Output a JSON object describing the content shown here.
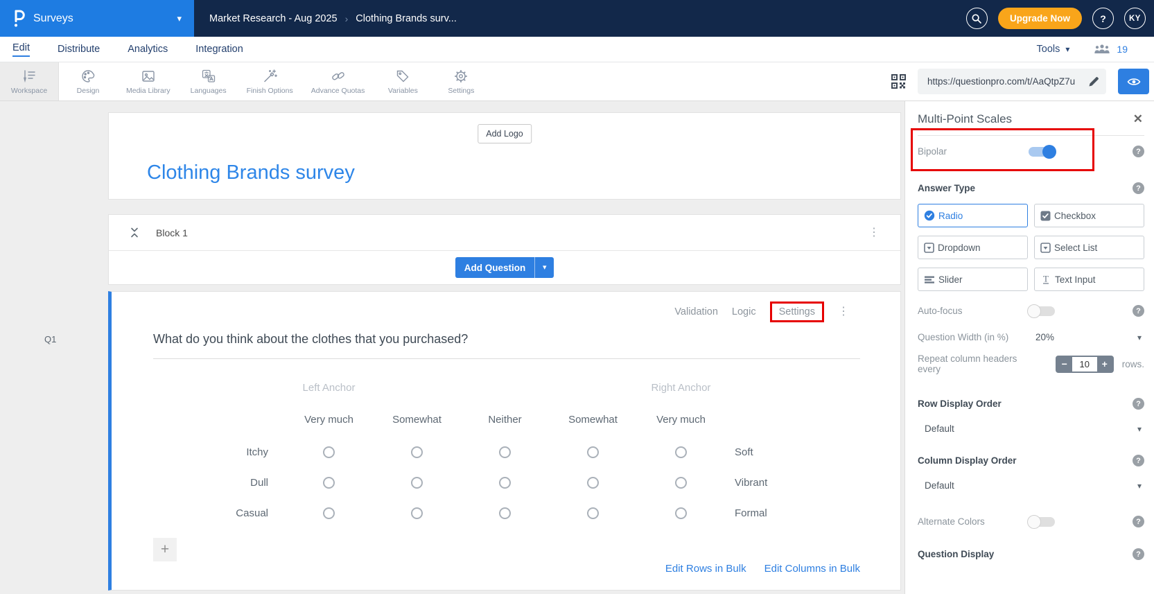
{
  "icons": {
    "help": "?",
    "kebab": "⋮",
    "close": "✕",
    "caret_down": "▾",
    "plus": "+",
    "minus": "−"
  },
  "colors": {
    "navy": "#12284a",
    "brand_blue": "#1e7ce2",
    "accent_blue": "#2e7fe1",
    "title_blue": "#2e86e8",
    "orange": "#f9a51a",
    "highlight_red": "#e60000"
  },
  "topbar": {
    "product": "Surveys",
    "breadcrumb": [
      "Market Research - Aug 2025",
      "Clothing Brands surv..."
    ],
    "breadcrumb_separator": "›",
    "upgrade_label": "Upgrade Now",
    "avatar_initials": "KY"
  },
  "nav": {
    "tabs": [
      "Edit",
      "Distribute",
      "Analytics",
      "Integration"
    ],
    "active_tab": "Edit",
    "tools_label": "Tools",
    "collaborators_count": "19"
  },
  "toolbar": {
    "items": [
      "Workspace",
      "Design",
      "Media Library",
      "Languages",
      "Finish Options",
      "Advance Quotas",
      "Variables",
      "Settings"
    ],
    "active_item": "Workspace",
    "url_value": "https://questionpro.com/t/AaQtpZ7u"
  },
  "survey": {
    "add_logo_label": "Add Logo",
    "title": "Clothing Brands survey",
    "block": {
      "name": "Block 1",
      "add_question_label": "Add Question"
    },
    "question": {
      "id_label": "Q1",
      "menu_links": [
        "Validation",
        "Logic",
        "Settings"
      ],
      "text": "What do you think about the clothes that you purchased?",
      "left_anchor_label": "Left Anchor",
      "right_anchor_label": "Right Anchor",
      "scale_headers": [
        "Very much",
        "Somewhat",
        "Neither",
        "Somewhat",
        "Very much"
      ],
      "rows": [
        {
          "left": "Itchy",
          "right": "Soft"
        },
        {
          "left": "Dull",
          "right": "Vibrant"
        },
        {
          "left": "Casual",
          "right": "Formal"
        }
      ],
      "bulk_links": [
        "Edit Rows in Bulk",
        "Edit Columns in Bulk"
      ]
    }
  },
  "panel": {
    "title": "Multi-Point Scales",
    "bipolar_label": "Bipolar",
    "bipolar_on": true,
    "answer_type_label": "Answer Type",
    "answer_types": [
      "Radio",
      "Checkbox",
      "Dropdown",
      "Select List",
      "Slider",
      "Text Input"
    ],
    "selected_answer_type": "Radio",
    "auto_focus_label": "Auto-focus",
    "question_width_label": "Question Width (in %)",
    "question_width_value": "20%",
    "repeat_headers_label": "Repeat column headers every",
    "repeat_headers_value": "10",
    "repeat_headers_suffix": "rows.",
    "row_display_order_label": "Row Display Order",
    "row_display_order_value": "Default",
    "column_display_order_label": "Column Display Order",
    "column_display_order_value": "Default",
    "alternate_colors_label": "Alternate Colors",
    "question_display_label": "Question Display"
  }
}
